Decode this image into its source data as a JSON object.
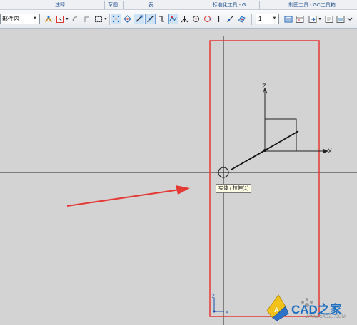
{
  "ribbon_groups": [
    "注释",
    "草图",
    "表",
    "标准化工具 - G...",
    "制图工具 - GC工具箱"
  ],
  "toolbar": {
    "selection_filter": "部件内",
    "layer_value": "1"
  },
  "tooltip": "实体 / 拉伸(1)",
  "axes": {
    "z_label": "Z",
    "x_label": "X",
    "small_z_label": "Z",
    "small_x_label": "X"
  },
  "watermark": {
    "brand": "CAD之家",
    "logo_letter": "A",
    "url": "WWW.CADZJ.COM"
  },
  "colors": {
    "canvas": "#d3d3d3",
    "highlight": "#e53935",
    "arrow": "#e53935",
    "brand": "#1f6fc1",
    "tooltip_bg": "#ffffe8"
  }
}
